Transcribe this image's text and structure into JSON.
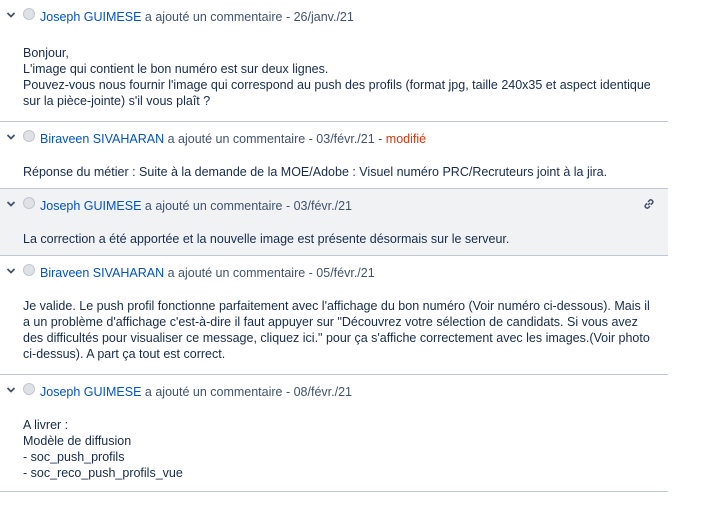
{
  "comments": [
    {
      "author": "Joseph GUIMESE",
      "action": " a ajouté un commentaire - ",
      "date": "26/janv./21",
      "modified": "",
      "lines": [
        "Bonjour,",
        "L'image qui contient le bon numéro est sur deux lignes.",
        "Pouvez-vous nous fournir l'image qui correspond au push des profils (format jpg, taille 240x35 et aspect identique",
        "sur la pièce-jointe) s'il vous plaît ?"
      ]
    },
    {
      "author": "Biraveen SIVAHARAN",
      "action": " a ajouté un commentaire - ",
      "date": "03/févr./21",
      "modified": "modifié",
      "modified_sep": " - ",
      "lines": [
        "Réponse du métier : Suite à la demande de la MOE/Adobe : Visuel numéro PRC/Recruteurs joint à la jira."
      ]
    },
    {
      "author": "Joseph GUIMESE",
      "action": " a ajouté un commentaire - ",
      "date": "03/févr./21",
      "modified": "",
      "permalink_icon": "link-icon",
      "lines": [
        "La correction a été apportée et la nouvelle image est présente désormais sur le serveur."
      ]
    },
    {
      "author": "Biraveen SIVAHARAN",
      "action": " a ajouté un commentaire - ",
      "date": "05/févr./21",
      "modified": "",
      "lines": [
        "Je valide. Le push profil fonctionne parfaitement avec l'affichage du bon numéro (Voir numéro ci-dessous). Mais il",
        "a un problème d'affichage c'est-à-dire il faut appuyer sur \"Découvrez votre sélection de candidats. Si vous avez",
        "des difficultés pour visualiser ce message, cliquez ici.\" pour ça s'affiche correctement avec les images.(Voir photo",
        "ci-dessus). A part ça tout est correct."
      ]
    },
    {
      "author": "Joseph GUIMESE",
      "action": " a ajouté un commentaire - ",
      "date": "08/févr./21",
      "modified": "",
      "lines": [
        "A livrer :",
        "Modèle de diffusion",
        "- soc_push_profils",
        "- soc_reco_push_profils_vue"
      ]
    }
  ],
  "colors": {
    "author": "#0052cc",
    "modified": "#de350b",
    "text": "#172b4d",
    "highlight": "#f1f2f4"
  }
}
